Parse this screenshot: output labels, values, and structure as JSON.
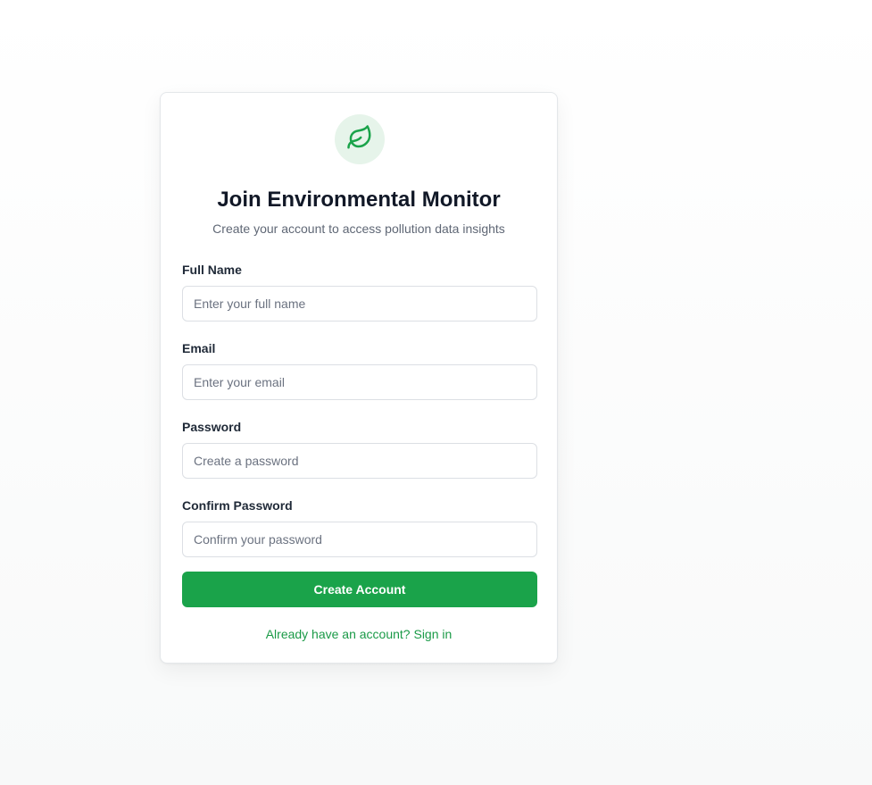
{
  "brand": {
    "icon": "leaf-icon",
    "accent_color": "#1aa34a",
    "icon_bg_color": "#e6f4ea"
  },
  "form": {
    "title": "Join Environmental Monitor",
    "subtitle": "Create your account to access pollution data insights",
    "fields": [
      {
        "label": "Full Name",
        "placeholder": "Enter your full name",
        "value": ""
      },
      {
        "label": "Email",
        "placeholder": "Enter your email",
        "value": ""
      },
      {
        "label": "Password",
        "placeholder": "Create a password",
        "value": ""
      },
      {
        "label": "Confirm Password",
        "placeholder": "Confirm your password",
        "value": ""
      }
    ],
    "submit_label": "Create Account",
    "signin_text": "Already have an account? Sign in"
  }
}
